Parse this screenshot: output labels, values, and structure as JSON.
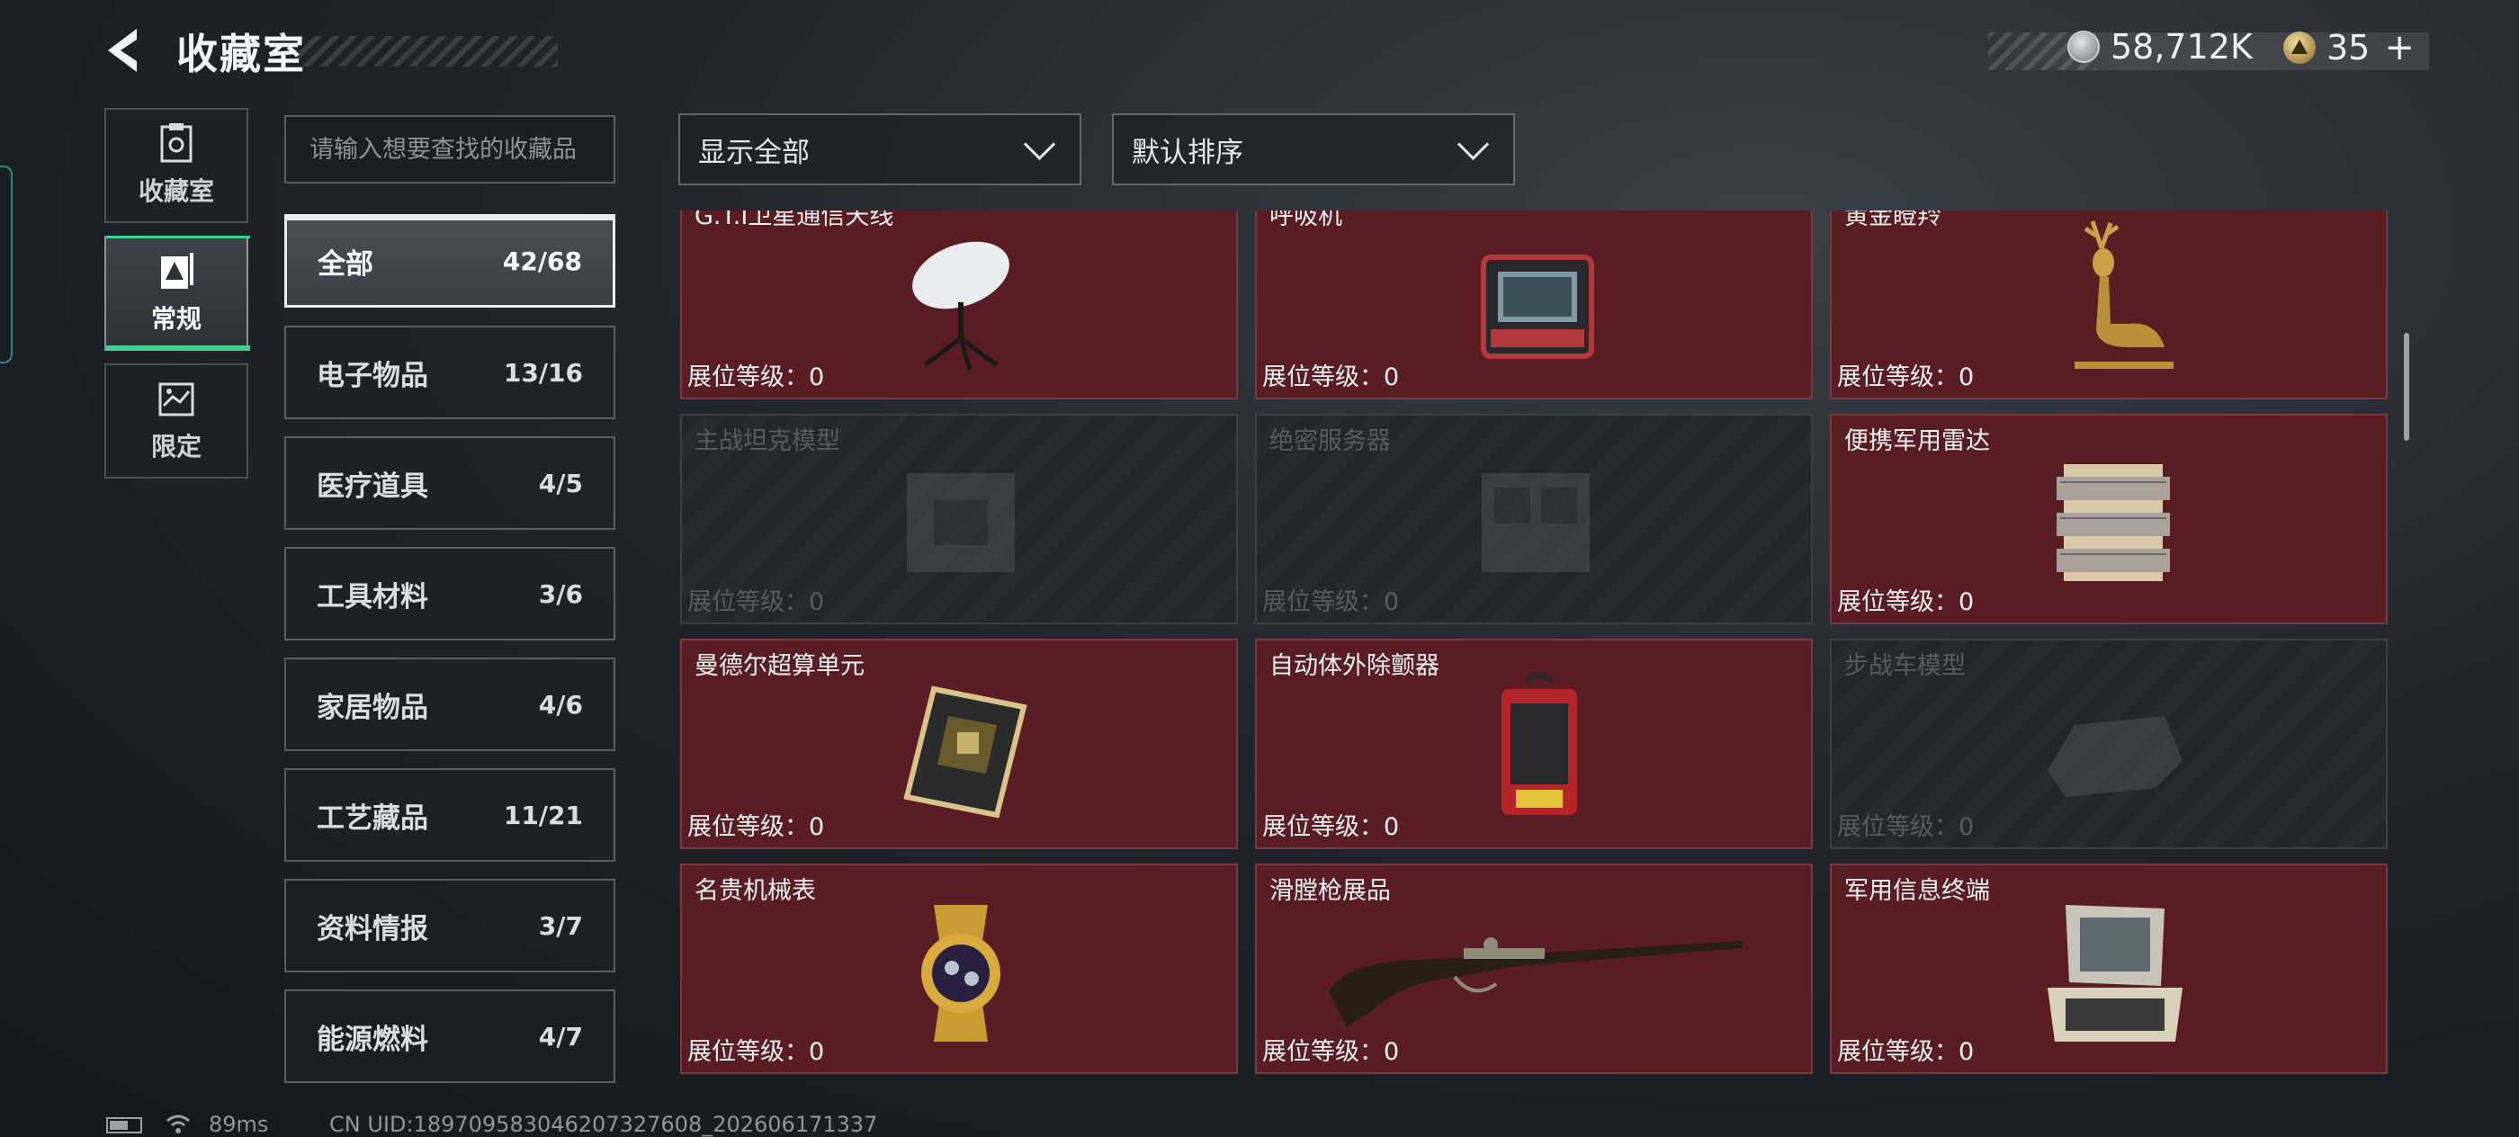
{
  "header": {
    "title": "收藏室",
    "back_icon": "back-arrow-icon"
  },
  "currency": {
    "coins": "58,712K",
    "tokens": "35",
    "plus": "+"
  },
  "side_nav": [
    {
      "label": "收藏室",
      "icon": "collection-box-icon",
      "active": false
    },
    {
      "label": "常规",
      "icon": "regular-card-icon",
      "active": true
    },
    {
      "label": "限定",
      "icon": "limited-map-icon",
      "active": false
    }
  ],
  "search": {
    "placeholder": "请输入想要查找的收藏品"
  },
  "categories": [
    {
      "name": "全部",
      "count": "42/68",
      "active": true
    },
    {
      "name": "电子物品",
      "count": "13/16"
    },
    {
      "name": "医疗道具",
      "count": "4/5"
    },
    {
      "name": "工具材料",
      "count": "3/6"
    },
    {
      "name": "家居物品",
      "count": "4/6"
    },
    {
      "name": "工艺藏品",
      "count": "11/21"
    },
    {
      "name": "资料情报",
      "count": "3/7"
    },
    {
      "name": "能源燃料",
      "count": "4/7"
    }
  ],
  "filters": {
    "display": "显示全部",
    "sort": "默认排序"
  },
  "items": [
    {
      "name": "G.T.I卫星通信天线",
      "level": "展位等级：0",
      "owned": true,
      "icon": "satellite-dish-icon"
    },
    {
      "name": "呼吸机",
      "level": "展位等级：0",
      "owned": true,
      "icon": "ventilator-icon"
    },
    {
      "name": "黄金瞪羚",
      "level": "展位等级：0",
      "owned": true,
      "icon": "golden-gazelle-icon"
    },
    {
      "name": "主战坦克模型",
      "level": "展位等级：0",
      "owned": false,
      "icon": "tank-model-icon"
    },
    {
      "name": "绝密服务器",
      "level": "展位等级：0",
      "owned": false,
      "icon": "server-icon"
    },
    {
      "name": "便携军用雷达",
      "level": "展位等级：0",
      "owned": true,
      "icon": "portable-radar-icon"
    },
    {
      "name": "曼德尔超算单元",
      "level": "展位等级：0",
      "owned": true,
      "icon": "supercomputer-unit-icon"
    },
    {
      "name": "自动体外除颤器",
      "level": "展位等级：0",
      "owned": true,
      "icon": "defibrillator-icon"
    },
    {
      "name": "步战车模型",
      "level": "展位等级：0",
      "owned": false,
      "icon": "ifv-model-icon"
    },
    {
      "name": "名贵机械表",
      "level": "展位等级：0",
      "owned": true,
      "icon": "luxury-watch-icon"
    },
    {
      "name": "滑膛枪展品",
      "level": "展位等级：0",
      "owned": true,
      "icon": "musket-icon"
    },
    {
      "name": "军用信息终端",
      "level": "展位等级：0",
      "owned": true,
      "icon": "military-terminal-icon"
    }
  ],
  "status": {
    "ping": "89ms",
    "uid": "CN UID:18970958304620732760​8_202606171337"
  }
}
